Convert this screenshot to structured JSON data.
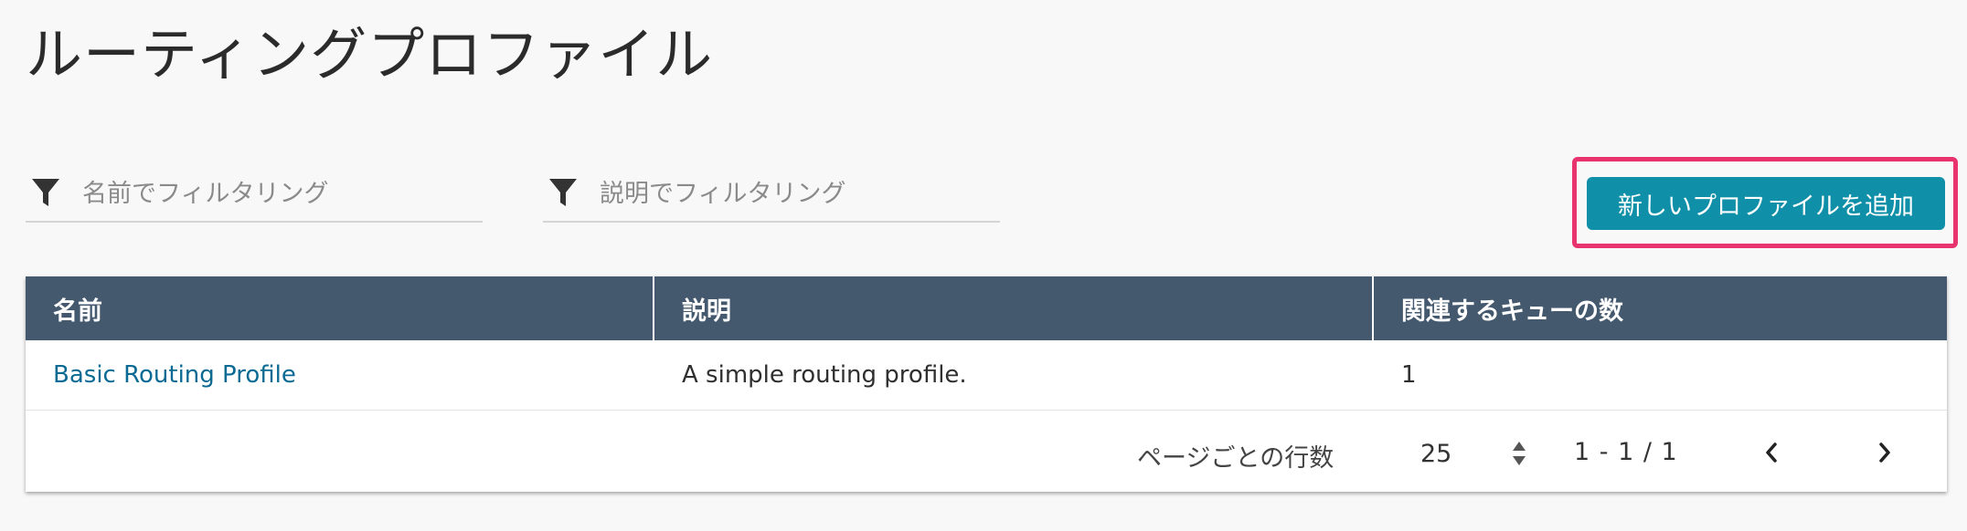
{
  "header": {
    "title": "ルーティングプロファイル"
  },
  "filters": {
    "name_placeholder": "名前でフィルタリング",
    "description_placeholder": "説明でフィルタリング",
    "icon": "filter-icon"
  },
  "toolbar": {
    "add_label": "新しいプロファイルを追加",
    "highlight_color": "#e8336f",
    "button_color": "#0f8fa8"
  },
  "table": {
    "header_color": "#44586e",
    "columns": [
      "名前",
      "説明",
      "関連するキューの数"
    ],
    "rows": [
      {
        "name": "Basic Routing Profile",
        "description": "A simple routing profile.",
        "queue_count": "1"
      }
    ]
  },
  "pagination": {
    "rows_per_page_label": "ページごとの行数",
    "rows_per_page_value": "25",
    "range_text": "1 - 1 / 1",
    "prev_icon": "chevron-left-icon",
    "next_icon": "chevron-right-icon"
  }
}
